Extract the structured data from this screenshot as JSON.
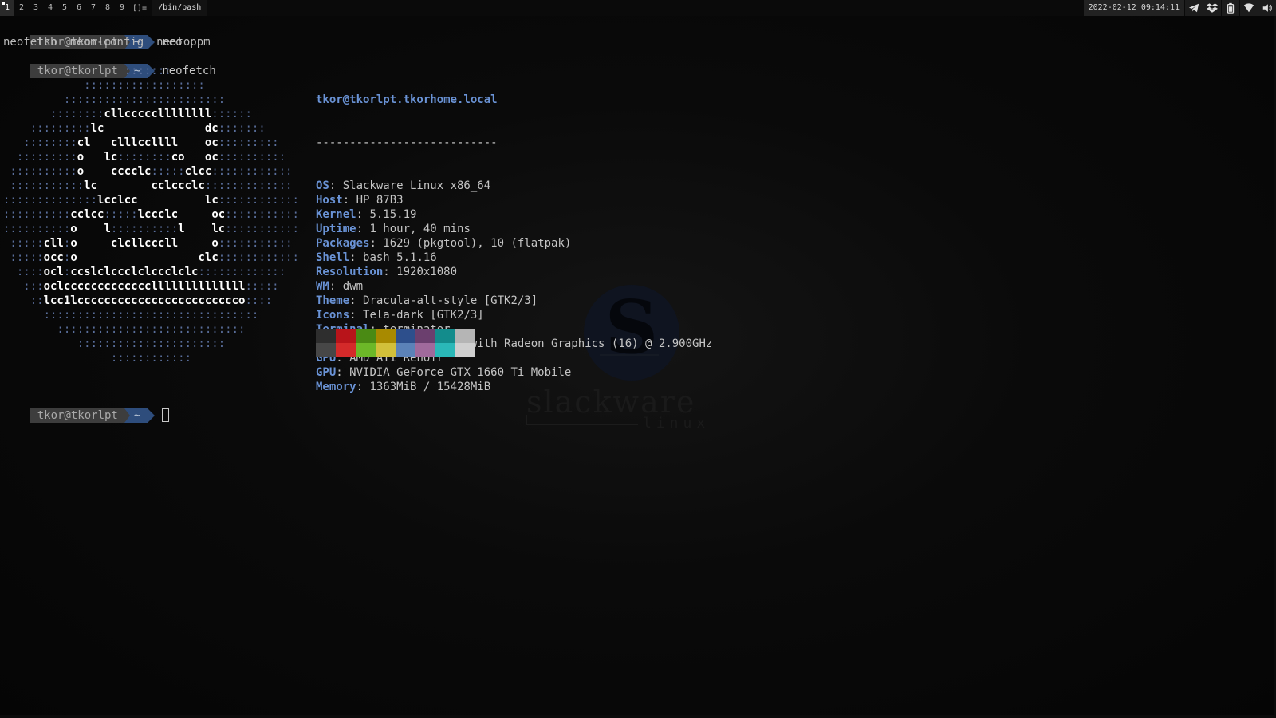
{
  "topbar": {
    "tags": [
      "1",
      "2",
      "3",
      "4",
      "5",
      "6",
      "7",
      "8",
      "9"
    ],
    "active_tag": "1",
    "layout_symbol": "[]=",
    "window_title": "/bin/bash",
    "clock": "2022-02-12 09:14:11",
    "tray_icons": [
      "telegram-icon",
      "dropbox-icon",
      "battery-icon",
      "wifi-icon",
      "volume-icon"
    ]
  },
  "terminal": {
    "prompt_user": "tkor@tkorlpt",
    "prompt_dir": "~",
    "cmd1": "neo",
    "completions": [
      "neofetch",
      "neon-config",
      "neotoppm"
    ],
    "cmd2": "neofetch"
  },
  "neofetch": {
    "title": "tkor@tkorlpt.tkorhome.local",
    "separator": "---------------------------",
    "fields": [
      {
        "key": "OS",
        "value": "Slackware Linux x86_64"
      },
      {
        "key": "Host",
        "value": "HP 87B3"
      },
      {
        "key": "Kernel",
        "value": "5.15.19"
      },
      {
        "key": "Uptime",
        "value": "1 hour, 40 mins"
      },
      {
        "key": "Packages",
        "value": "1629 (pkgtool), 10 (flatpak)"
      },
      {
        "key": "Shell",
        "value": "bash 5.1.16"
      },
      {
        "key": "Resolution",
        "value": "1920x1080"
      },
      {
        "key": "WM",
        "value": "dwm"
      },
      {
        "key": "Theme",
        "value": "Dracula-alt-style [GTK2/3]"
      },
      {
        "key": "Icons",
        "value": "Tela-dark [GTK2/3]"
      },
      {
        "key": "Terminal",
        "value": "terminator"
      },
      {
        "key": "CPU",
        "value": "AMD Ryzen 7 4800H with Radeon Graphics (16) @ 2.900GHz"
      },
      {
        "key": "GPU",
        "value": "AMD ATI Renoir"
      },
      {
        "key": "GPU",
        "value": "NVIDIA GeForce GTX 1660 Ti Mobile"
      },
      {
        "key": "Memory",
        "value": "1363MiB / 15428MiB"
      }
    ],
    "palette_colors": [
      "#2e2e2e",
      "#b8141a",
      "#4a8a14",
      "#a88a00",
      "#2d4f8c",
      "#6b3f6e",
      "#138c8c",
      "#b5b5b5",
      "#474747",
      "#d42a2a",
      "#6cb828",
      "#d2c03a",
      "#5b82b8",
      "#a06a9c",
      "#2ab8b8",
      "#cfcfcf"
    ]
  },
  "ascii_art": [
    "                  :::::::",
    "            ::::::::::::::::::",
    "         ::::::::::::::::::::::::",
    "       ::::::::[[cllcccccllllllll]]::::::",
    "    :::::::::[[lc]]               [[dc]]:::::::",
    "   ::::::::[[cl]]   [[clllccllll]]    [[oc]]:::::::::",
    "  :::::::::[[o]]   [[lc]]::::::::[[co]]   [[oc]]::::::::::",
    " ::::::::::[[o]]    [[cccclc]]:::::[[clcc]]::::::::::::",
    " :::::::::::[[lc]]        [[cclccclc]]:::::::::::::",
    "::::::::::::::[[lcclcc]]          [[lc]]::::::::::::",
    "::::::::::[[cclcc]]:::::[[lccclc]]     [[oc]]:::::::::::",
    "::::::::::[[o]]    [[l]]::::::::::[[l]]    [[lc]]:::::::::::",
    " :::::[[cll]]:[[o]]     [[clcllcccll]]     [[o]]:::::::::::",
    " :::::[[occ]]:[[o]]                  [[clc]]::::::::::::",
    "  ::::[[ocl]]:[[ccslclccclclccclclc]]:::::::::::::",
    "   :::[[oclcccccccccccccllllllllllllll]]:::::",
    "    ::[[lcc1lcccccccccccccccccccccccco]]::::",
    "      ::::::::::::::::::::::::::::::::",
    "        ::::::::::::::::::::::::::::",
    "           ::::::::::::::::::::::",
    "                ::::::::::::"
  ],
  "watermark": {
    "letter": "S",
    "word": "slackware",
    "sub": "linux"
  }
}
